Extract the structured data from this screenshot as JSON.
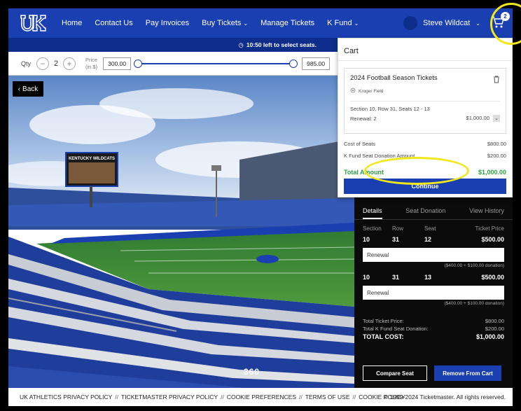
{
  "nav": {
    "items": [
      {
        "label": "Home"
      },
      {
        "label": "Contact Us"
      },
      {
        "label": "Pay Invoices"
      },
      {
        "label": "Buy Tickets",
        "dropdown": true
      },
      {
        "label": "Manage Tickets"
      },
      {
        "label": "K Fund",
        "dropdown": true
      }
    ],
    "user_name": "Steve Wildcat",
    "cart_count": "2"
  },
  "timer": {
    "text": "10:50 left to select seats."
  },
  "filter": {
    "qty_label": "Qty",
    "qty_value": "2",
    "price_label_line1": "Price",
    "price_label_line2": "(in $)",
    "price_min": "300.00",
    "price_max": "985.00",
    "slider_low_fraction": 0.0,
    "slider_high_fraction": 1.0
  },
  "stadium": {
    "back_label": "Back",
    "view360": "360",
    "scoreboard_text": "KENTUCKY WILDCATS"
  },
  "panel": {
    "tabs": [
      "Details",
      "Seat Donation",
      "View History"
    ],
    "headers": [
      "Section",
      "Row",
      "Seat",
      "Ticket Price"
    ],
    "seats": [
      {
        "section": "10",
        "row": "31",
        "seat": "12",
        "price": "$500.00",
        "type": "Renewal",
        "breakdown": "($400.00 + $100.00 donation)"
      },
      {
        "section": "10",
        "row": "31",
        "seat": "13",
        "price": "$500.00",
        "type": "Renewal",
        "breakdown": "($400.00 + $100.00 donation)"
      }
    ],
    "total_ticket_label": "Total Ticket Price:",
    "total_ticket_value": "$800.00",
    "total_kfund_label": "Total K Fund Seat Donation:",
    "total_kfund_value": "$200.00",
    "total_cost_label": "TOTAL COST:",
    "total_cost_value": "$1,000.00",
    "compare_label": "Compare Seat",
    "remove_label": "Remove From Cart"
  },
  "cart": {
    "title": "Cart",
    "item_title": "2024 Football Season Tickets",
    "venue": "Kroger Field",
    "seats_line": "Section 10, Row 31, Seats 12 - 13",
    "renewal_label": "Renewal: 2",
    "renewal_amount": "$1,000.00",
    "cost_label": "Cost of Seats",
    "cost_value": "$800.00",
    "donation_label": "K Fund Seat Donation Amount",
    "donation_value": "$200.00",
    "total_label": "Total Amount",
    "total_value": "$1,000.00",
    "continue_label": "Continue"
  },
  "footer": {
    "links": [
      "UK ATHLETICS PRIVACY POLICY",
      "TICKETMASTER PRIVACY POLICY",
      "COOKIE PREFERENCES",
      "TERMS OF USE",
      "COOKIE POLICY"
    ],
    "separator": "//",
    "copyright": "© 1999-2024 Ticketmaster. All rights reserved."
  },
  "colors": {
    "brand_blue": "#1a3fb0",
    "dark_blue": "#0e2d8a",
    "highlight_yellow": "#f2e71a",
    "total_green": "#2ea043"
  }
}
